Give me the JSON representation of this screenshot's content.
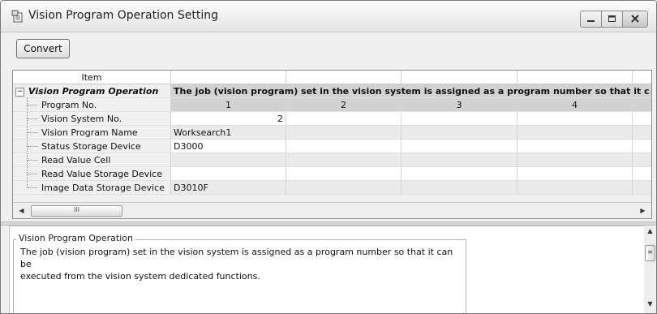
{
  "window": {
    "title": "Vision Program Operation Setting",
    "icon": "settings-document-icon",
    "minimize_icon": "minimize-icon",
    "maximize_icon": "maximize-icon",
    "close_icon": "close-icon"
  },
  "toolbar": {
    "convert_label": "Convert"
  },
  "grid": {
    "header": {
      "item": "Item",
      "col1": "",
      "col2": "",
      "col3": "",
      "col4": "",
      "col5": ""
    },
    "group": {
      "toggle": "−",
      "label": "Vision Program Operation",
      "description": "The job (vision program) set in the vision system is assigned as a program number so that it c..."
    },
    "rows": [
      {
        "label": "Program No.",
        "values": [
          "1",
          "2",
          "3",
          "4",
          ""
        ]
      },
      {
        "label": "Vision System No.",
        "values": [
          "2",
          "",
          "",
          "",
          ""
        ]
      },
      {
        "label": "Vision Program Name",
        "values": [
          "Worksearch1",
          "",
          "",
          "",
          ""
        ]
      },
      {
        "label": "Status Storage Device",
        "values": [
          "D3000",
          "",
          "",
          "",
          ""
        ]
      },
      {
        "label": "Read Value Cell",
        "values": [
          "",
          "",
          "",
          "",
          ""
        ]
      },
      {
        "label": "Read Value Storage Device",
        "values": [
          "",
          "",
          "",
          "",
          ""
        ]
      },
      {
        "label": "Image Data Storage Device",
        "values": [
          "D3010F",
          "",
          "",
          "",
          ""
        ]
      }
    ]
  },
  "hscroll": {
    "left_arrow": "◀",
    "right_arrow": "▶",
    "thumb_grip": "III"
  },
  "description_panel": {
    "title": "Vision Program Operation",
    "line1": "The job (vision program) set in the vision system is assigned as a program number so that it can be",
    "line2": "executed from the vision system dedicated functions."
  },
  "vscroll": {
    "up_arrow": "▲",
    "down_arrow": "▼",
    "thumb_grip": "≡"
  },
  "colors": {
    "title_bar": "#ececec",
    "group_band": "#d2d2d2",
    "alt_row": "#eaeaea",
    "item_column": "#f0f0f0"
  }
}
